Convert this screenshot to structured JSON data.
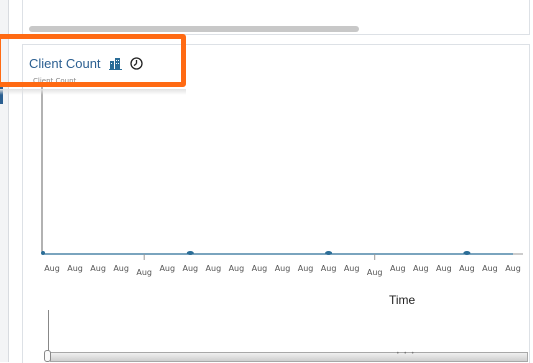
{
  "panel": {
    "title": "Client Count",
    "icons": [
      "building-chart-icon",
      "clock-icon"
    ],
    "title_color": "#2b5f91"
  },
  "highlight": {
    "color": "#ff6a13"
  },
  "chart_data": {
    "type": "line",
    "ylabel": "Client Count",
    "xlabel": "Time",
    "x": [
      "Aug",
      "Aug",
      "Aug",
      "Aug",
      "Aug",
      "Aug",
      "Aug",
      "Aug",
      "Aug",
      "Aug",
      "Aug",
      "Aug",
      "Aug",
      "Aug",
      "Aug",
      "Aug",
      "Aug",
      "Aug",
      "Aug",
      "Aug",
      "Aug"
    ],
    "series": [
      {
        "values": [
          0,
          0,
          0,
          0,
          0,
          0,
          0,
          0,
          0,
          0,
          0,
          0,
          0,
          0,
          0,
          0,
          0,
          0,
          0,
          0,
          0
        ]
      }
    ],
    "marker_indices": [
      0,
      6,
      12,
      18
    ],
    "line_color": "#2b6d97",
    "grid": false
  },
  "navigator": {
    "grip": "• • •"
  }
}
